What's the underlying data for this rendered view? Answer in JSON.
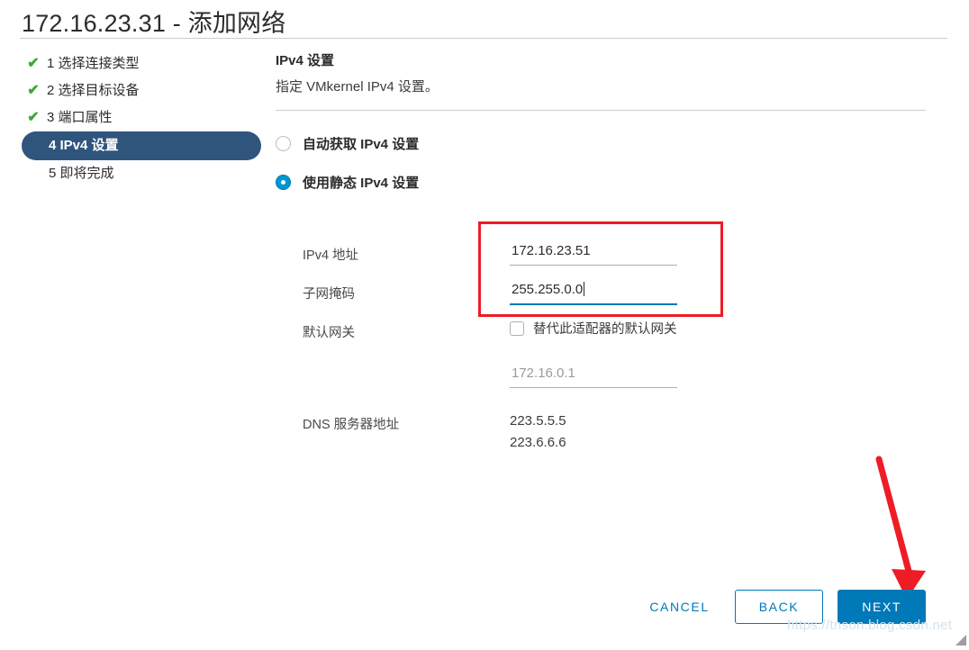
{
  "dialog": {
    "title": "172.16.23.31 - 添加网络"
  },
  "steps": [
    {
      "label": "1 选择连接类型",
      "state": "done",
      "check": "✔"
    },
    {
      "label": "2 选择目标设备",
      "state": "done",
      "check": "✔"
    },
    {
      "label": "3 端口属性",
      "state": "done",
      "check": "✔"
    },
    {
      "label": "4 IPv4 设置",
      "state": "active",
      "check": ""
    },
    {
      "label": "5 即将完成",
      "state": "pending",
      "check": ""
    }
  ],
  "panel": {
    "heading": "IPv4 设置",
    "subtitle": "指定 VMkernel IPv4 设置。"
  },
  "radios": [
    {
      "label": "自动获取 IPv4 设置",
      "selected": false
    },
    {
      "label": "使用静态 IPv4 设置",
      "selected": true
    }
  ],
  "form": {
    "ipv4_address": {
      "label": "IPv4 地址",
      "value": "172.16.23.51",
      "focused": false
    },
    "subnet_mask": {
      "label": "子网掩码",
      "value": "255.255.0.0",
      "focused": true
    },
    "default_gateway": {
      "label": "默认网关",
      "checkbox_label": "替代此适配器的默认网关",
      "checked": false,
      "value": "172.16.0.1",
      "disabled": true
    },
    "dns": {
      "label": "DNS 服务器地址",
      "servers": [
        "223.5.5.5",
        "223.6.6.6"
      ]
    }
  },
  "footer": {
    "cancel": "CANCEL",
    "back": "BACK",
    "next": "NEXT"
  },
  "watermark": "https://tnson.blog.csdn.net",
  "colors": {
    "accent_blue": "#0079b8",
    "active_step": "#30557d",
    "check_green": "#37a935",
    "annotation_red": "#ee1c25"
  }
}
